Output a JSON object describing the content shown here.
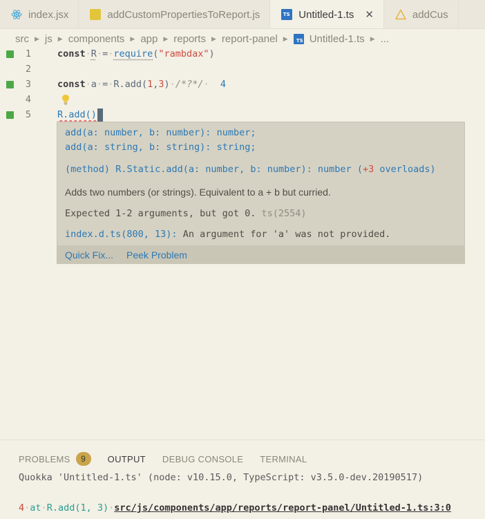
{
  "tabs": [
    {
      "label": "index.jsx",
      "icon": "react-icon",
      "active": false
    },
    {
      "label": "addCustomPropertiesToReport.js",
      "icon": "js-file-icon",
      "active": false
    },
    {
      "label": "Untitled-1.ts",
      "icon": "ts-file-icon",
      "active": true,
      "close": "✕"
    },
    {
      "label": "addCus",
      "icon": "warning-icon",
      "active": false
    }
  ],
  "breadcrumb": [
    "src",
    "js",
    "components",
    "app",
    "reports",
    "report-panel",
    "Untitled-1.ts",
    "..."
  ],
  "editor": {
    "line_numbers": [
      "1",
      "2",
      "3",
      "4",
      "5"
    ],
    "line1": {
      "kw": "const",
      "var": "R",
      "eq": "=",
      "fn": "require",
      "str": "\"rambdax\""
    },
    "line3": {
      "kw": "const",
      "var": "a",
      "eq": "=",
      "call": "R.add",
      "args_open": "(",
      "arg1": "1",
      "comma": ",",
      "arg2": "3",
      "args_close": ")",
      "comment": "/*?*/",
      "value": "4"
    },
    "line5": {
      "code": "R.add()"
    }
  },
  "hover": {
    "sig1": {
      "name": "add",
      "p1": "a",
      "t1": "number",
      "p2": "b",
      "t2": "number",
      "ret": "number"
    },
    "sig2": {
      "name": "add",
      "p1": "a",
      "t1": "string",
      "p2": "b",
      "t2": "string",
      "ret": "string"
    },
    "sig3": {
      "kind": "method",
      "name": "R.Static.add",
      "p1": "a",
      "t1": "number",
      "p2": "b",
      "t2": "number",
      "ret": "number",
      "overloads_count": "+3",
      "overloads_word": "overloads"
    },
    "description": "Adds two numbers (or strings). Equivalent to a + b but curried.",
    "error_message": "Expected 1-2 arguments, but got 0.",
    "error_code": "ts(2554)",
    "related_location": "index.d.ts(800, 13):",
    "related_message": "An argument for 'a' was not provided.",
    "actions": [
      "Quick Fix...",
      "Peek Problem"
    ]
  },
  "panel": {
    "tabs": [
      "PROBLEMS",
      "OUTPUT",
      "DEBUG CONSOLE",
      "TERMINAL"
    ],
    "problems_count": "9",
    "active_tab": "OUTPUT",
    "output_line1": "Quokka 'Untitled-1.ts' (node: v10.15.0, TypeScript: v3.5.0-dev.20190517)",
    "output_value": "4",
    "output_at": "at",
    "output_call": "R.add(1, 3)",
    "output_path": "src/js/components/app/reports/report-panel/Untitled-1.ts:3:0"
  },
  "colors": {
    "background": "#f3f0e6",
    "tab_bar": "#ebe7dc",
    "hover_bg": "#d6d2c3",
    "accent_blue": "#2c78b4",
    "error_red": "#e05252",
    "gutter_green": "#4ca847",
    "badge": "#c9a44a"
  }
}
